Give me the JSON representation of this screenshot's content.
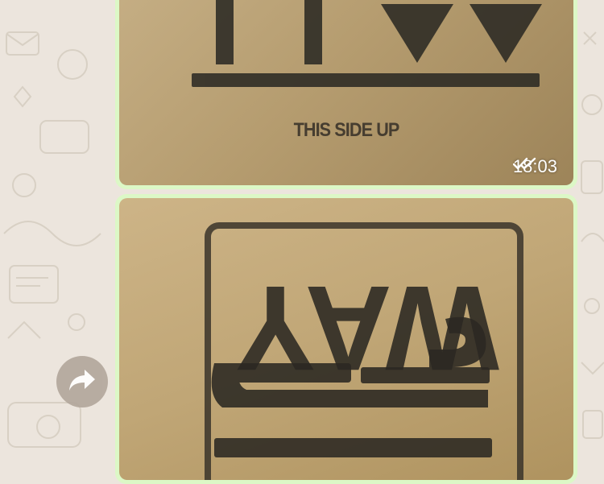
{
  "messages": [
    {
      "type": "image",
      "direction": "outgoing",
      "photo_caption_text": "THIS SIDE UP",
      "time": "18:03",
      "status_icon": "double-check-read-icon"
    },
    {
      "type": "image",
      "direction": "outgoing",
      "photo_caption_text": "WAY"
    }
  ],
  "actions": {
    "forward_icon": "forward-icon"
  },
  "colors": {
    "outgoing_bubble": "#dcf8c6",
    "chat_background": "#ece5dd",
    "forward_button": "#b2a69b"
  }
}
